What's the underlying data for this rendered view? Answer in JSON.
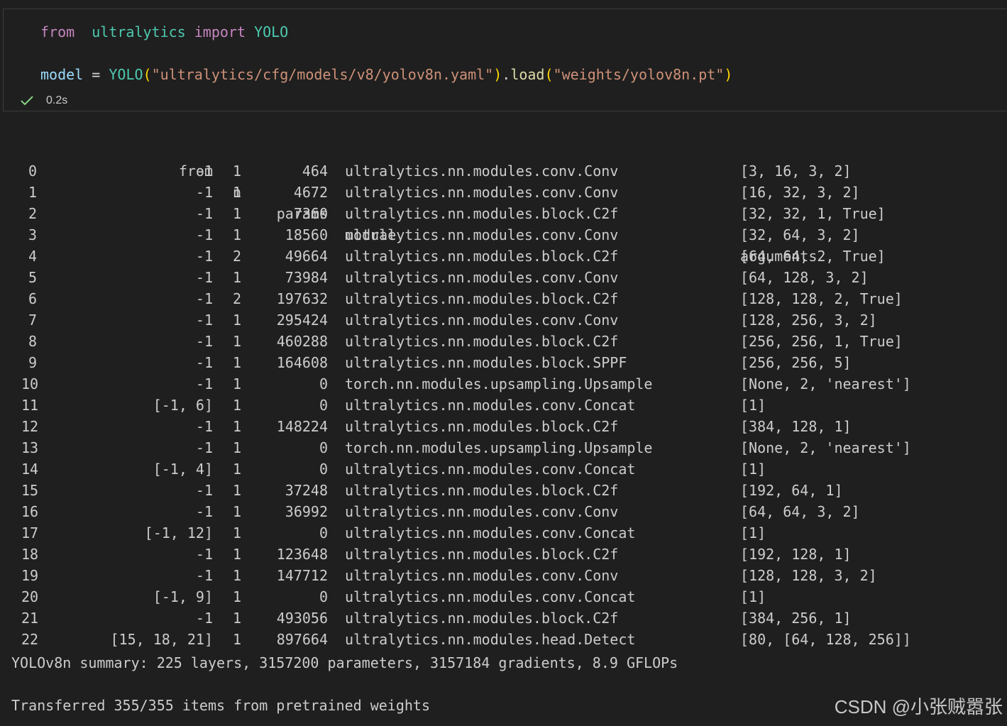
{
  "code_cell": {
    "line1": {
      "from": "from",
      "module": "ultralytics",
      "import": "import",
      "name": "YOLO"
    },
    "line2": {
      "var": "model",
      "eq": "=",
      "cls": "YOLO",
      "arg1": "\"ultralytics/cfg/models/v8/yolov8n.yaml\"",
      "method": "load",
      "arg2": "\"weights/yolov8n.pt\""
    },
    "status": {
      "time": "0.2s",
      "icon": "check-icon"
    }
  },
  "table": {
    "headers": {
      "from": "from",
      "n": "n",
      "params": "params",
      "module": "module",
      "arguments": "arguments"
    },
    "rows": [
      {
        "idx": "0",
        "from": "-1",
        "n": "1",
        "params": "464",
        "module": "ultralytics.nn.modules.conv.Conv",
        "args": "[3, 16, 3, 2]"
      },
      {
        "idx": "1",
        "from": "-1",
        "n": "1",
        "params": "4672",
        "module": "ultralytics.nn.modules.conv.Conv",
        "args": "[16, 32, 3, 2]"
      },
      {
        "idx": "2",
        "from": "-1",
        "n": "1",
        "params": "7360",
        "module": "ultralytics.nn.modules.block.C2f",
        "args": "[32, 32, 1, True]"
      },
      {
        "idx": "3",
        "from": "-1",
        "n": "1",
        "params": "18560",
        "module": "ultralytics.nn.modules.conv.Conv",
        "args": "[32, 64, 3, 2]"
      },
      {
        "idx": "4",
        "from": "-1",
        "n": "2",
        "params": "49664",
        "module": "ultralytics.nn.modules.block.C2f",
        "args": "[64, 64, 2, True]"
      },
      {
        "idx": "5",
        "from": "-1",
        "n": "1",
        "params": "73984",
        "module": "ultralytics.nn.modules.conv.Conv",
        "args": "[64, 128, 3, 2]"
      },
      {
        "idx": "6",
        "from": "-1",
        "n": "2",
        "params": "197632",
        "module": "ultralytics.nn.modules.block.C2f",
        "args": "[128, 128, 2, True]"
      },
      {
        "idx": "7",
        "from": "-1",
        "n": "1",
        "params": "295424",
        "module": "ultralytics.nn.modules.conv.Conv",
        "args": "[128, 256, 3, 2]"
      },
      {
        "idx": "8",
        "from": "-1",
        "n": "1",
        "params": "460288",
        "module": "ultralytics.nn.modules.block.C2f",
        "args": "[256, 256, 1, True]"
      },
      {
        "idx": "9",
        "from": "-1",
        "n": "1",
        "params": "164608",
        "module": "ultralytics.nn.modules.block.SPPF",
        "args": "[256, 256, 5]"
      },
      {
        "idx": "10",
        "from": "-1",
        "n": "1",
        "params": "0",
        "module": "torch.nn.modules.upsampling.Upsample",
        "args": "[None, 2, 'nearest']"
      },
      {
        "idx": "11",
        "from": "[-1, 6]",
        "n": "1",
        "params": "0",
        "module": "ultralytics.nn.modules.conv.Concat",
        "args": "[1]"
      },
      {
        "idx": "12",
        "from": "-1",
        "n": "1",
        "params": "148224",
        "module": "ultralytics.nn.modules.block.C2f",
        "args": "[384, 128, 1]"
      },
      {
        "idx": "13",
        "from": "-1",
        "n": "1",
        "params": "0",
        "module": "torch.nn.modules.upsampling.Upsample",
        "args": "[None, 2, 'nearest']"
      },
      {
        "idx": "14",
        "from": "[-1, 4]",
        "n": "1",
        "params": "0",
        "module": "ultralytics.nn.modules.conv.Concat",
        "args": "[1]"
      },
      {
        "idx": "15",
        "from": "-1",
        "n": "1",
        "params": "37248",
        "module": "ultralytics.nn.modules.block.C2f",
        "args": "[192, 64, 1]"
      },
      {
        "idx": "16",
        "from": "-1",
        "n": "1",
        "params": "36992",
        "module": "ultralytics.nn.modules.conv.Conv",
        "args": "[64, 64, 3, 2]"
      },
      {
        "idx": "17",
        "from": "[-1, 12]",
        "n": "1",
        "params": "0",
        "module": "ultralytics.nn.modules.conv.Concat",
        "args": "[1]"
      },
      {
        "idx": "18",
        "from": "-1",
        "n": "1",
        "params": "123648",
        "module": "ultralytics.nn.modules.block.C2f",
        "args": "[192, 128, 1]"
      },
      {
        "idx": "19",
        "from": "-1",
        "n": "1",
        "params": "147712",
        "module": "ultralytics.nn.modules.conv.Conv",
        "args": "[128, 128, 3, 2]"
      },
      {
        "idx": "20",
        "from": "[-1, 9]",
        "n": "1",
        "params": "0",
        "module": "ultralytics.nn.modules.conv.Concat",
        "args": "[1]"
      },
      {
        "idx": "21",
        "from": "-1",
        "n": "1",
        "params": "493056",
        "module": "ultralytics.nn.modules.block.C2f",
        "args": "[384, 256, 1]"
      },
      {
        "idx": "22",
        "from": "[15, 18, 21]",
        "n": "1",
        "params": "897664",
        "module": "ultralytics.nn.modules.head.Detect",
        "args": "[80, [64, 128, 256]]"
      }
    ]
  },
  "summary": "YOLOv8n summary: 225 layers, 3157200 parameters, 3157184 gradients, 8.9 GFLOPs",
  "transferred": "Transferred 355/355 items from pretrained weights",
  "watermark": "CSDN @小张贼嚣张",
  "colors": {
    "background": "#1f1f1f",
    "keyword": "#c586c0",
    "class": "#4ec9b0",
    "string": "#ce9178",
    "variable": "#9cdcfe",
    "function": "#dcdcaa",
    "paren": "#ffd700",
    "success": "#89d185"
  }
}
